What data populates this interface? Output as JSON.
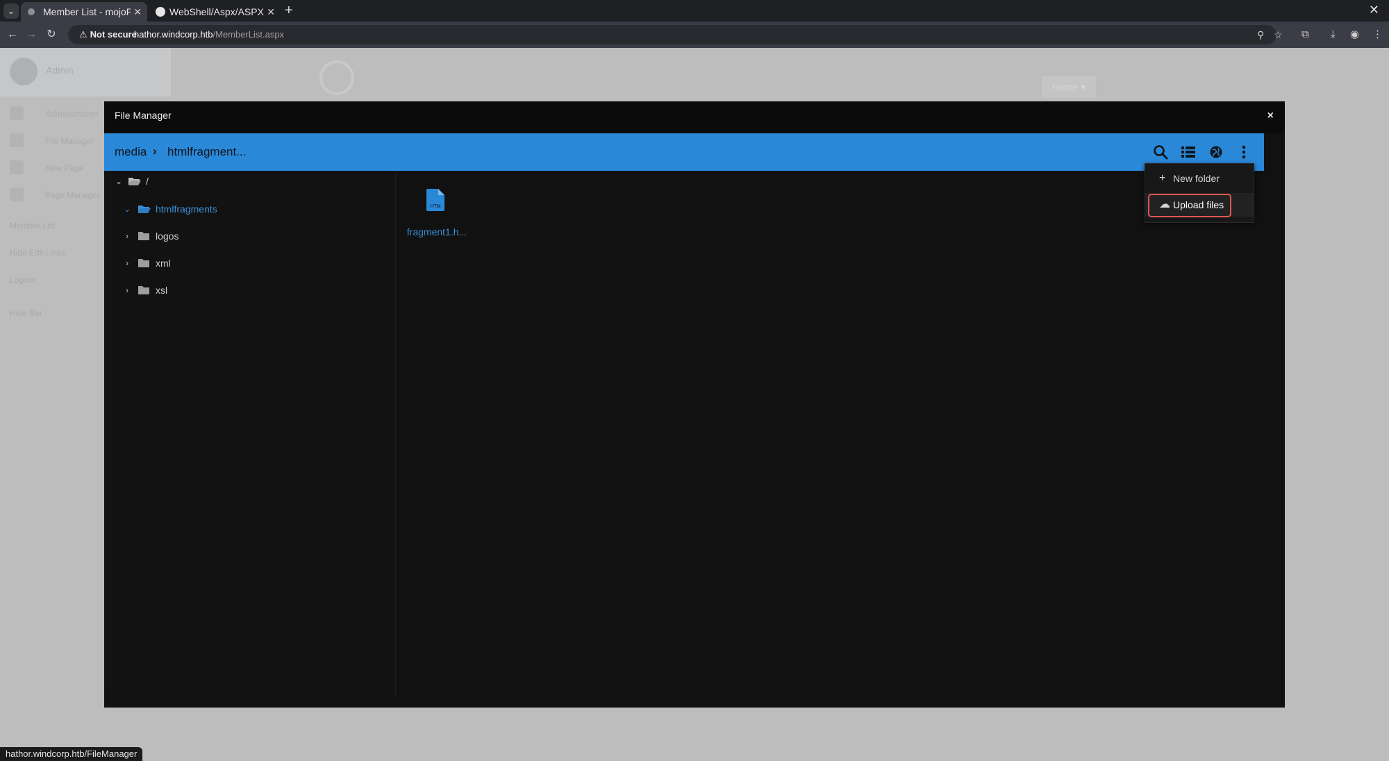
{
  "browser": {
    "tabs": [
      {
        "title": "Member List - mojoPortal",
        "active": true
      },
      {
        "title": "WebShell/Aspx/ASPX Shell",
        "active": false
      }
    ],
    "security_label": "Not secure",
    "url_host": "hathor.windcorp.htb",
    "url_path": "/MemberList.aspx",
    "status_url": "hathor.windcorp.htb/FileManager"
  },
  "page": {
    "admin_name": "Admin",
    "sidebar": [
      {
        "label": "Administration"
      },
      {
        "label": "File Manager"
      },
      {
        "label": "New Page"
      },
      {
        "label": "Page Manager"
      }
    ],
    "links": [
      "Member List",
      "Hide Edit Links",
      "Logout",
      "Hide Bar"
    ],
    "home_nav": "Home ▾"
  },
  "file_manager": {
    "title": "File Manager",
    "close": "×",
    "breadcrumb": [
      "media",
      "htmlfragment..."
    ],
    "toolbar_icons": [
      "search-icon",
      "list-view-icon",
      "globe-icon",
      "more-vert-icon"
    ],
    "tree": {
      "root": "/",
      "folders": [
        {
          "label": "htmlfragments",
          "expanded": true,
          "selected": true
        },
        {
          "label": "logos",
          "expanded": false,
          "selected": false
        },
        {
          "label": "xml",
          "expanded": false,
          "selected": false
        },
        {
          "label": "xsl",
          "expanded": false,
          "selected": false
        }
      ]
    },
    "files": [
      {
        "name": "fragment1.h...",
        "type": "HTM"
      }
    ],
    "menu": {
      "items": [
        {
          "label": "New folder",
          "icon": "plus-icon"
        },
        {
          "label": "Upload files",
          "icon": "cloud-upload-icon"
        }
      ]
    }
  },
  "colors": {
    "accent": "#2a88d8",
    "link": "#3b8fd6",
    "highlight_border": "#e05555"
  }
}
